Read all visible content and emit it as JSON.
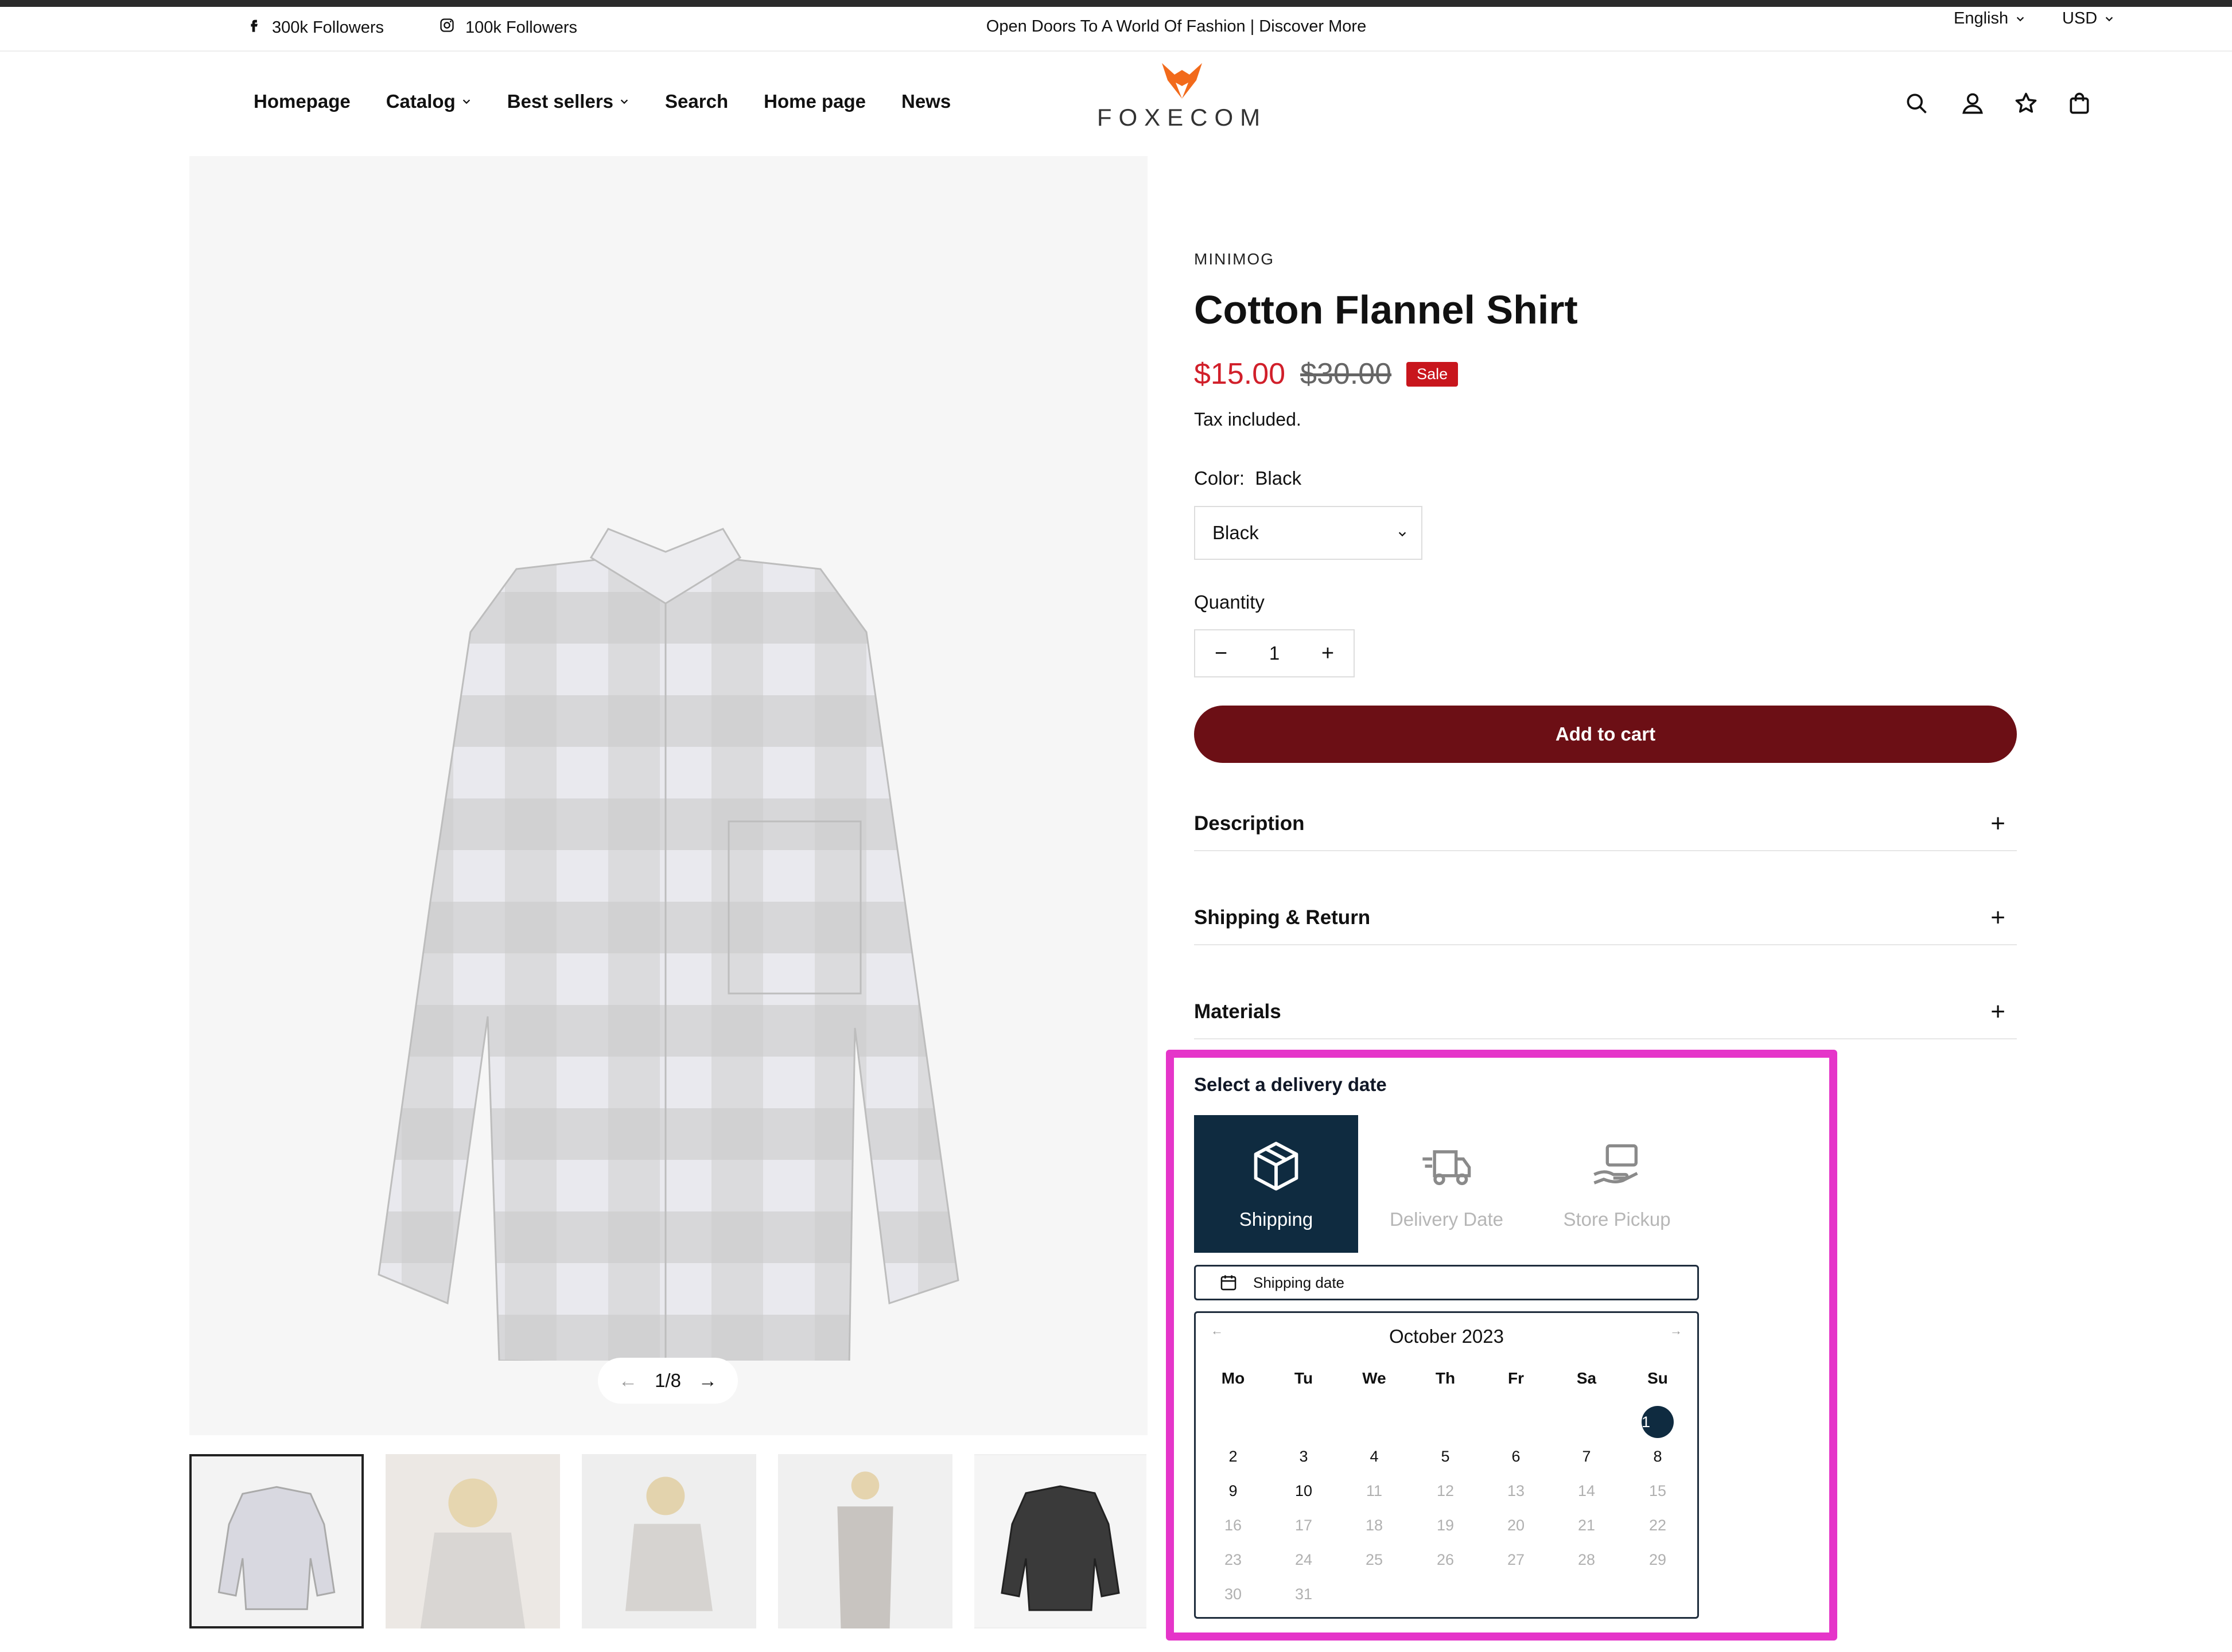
{
  "announcement": {
    "facebook": "300k Followers",
    "instagram": "100k Followers",
    "message": "Open Doors To A World Of Fashion | Discover More",
    "language": "English",
    "currency": "USD"
  },
  "header": {
    "logo_text": "FOXECOM",
    "nav": [
      "Homepage",
      "Catalog",
      "Best sellers",
      "Search",
      "Home page",
      "News"
    ]
  },
  "gallery": {
    "counter": "1/8",
    "thumbnails": [
      "grey plaid shirt",
      "model back view",
      "model seated",
      "model full outfit",
      "black plaid shirt"
    ]
  },
  "product": {
    "vendor": "MINIMOG",
    "title": "Cotton Flannel Shirt",
    "price": "$15.00",
    "compare_price": "$30.00",
    "badge": "Sale",
    "tax_note": "Tax included.",
    "color_label": "Color:",
    "color_value": "Black",
    "color_select": "Black",
    "quantity_label": "Quantity",
    "quantity": "1",
    "add_to_cart": "Add to cart",
    "accordions": [
      "Description",
      "Shipping & Return",
      "Materials"
    ]
  },
  "delivery": {
    "title": "Select a delivery date",
    "options": [
      "Shipping",
      "Delivery Date",
      "Store Pickup"
    ],
    "input_placeholder": "Shipping date",
    "month": "October 2023",
    "weekdays": [
      "Mo",
      "Tu",
      "We",
      "Th",
      "Fr",
      "Sa",
      "Su"
    ],
    "selected_day": 1,
    "available_days": [
      1,
      2,
      3,
      4,
      5,
      6,
      7,
      8,
      9,
      10
    ],
    "disabled_days": [
      11,
      12,
      13,
      14,
      15,
      16,
      17,
      18,
      19,
      20,
      21,
      22,
      23,
      24,
      25,
      26,
      27,
      28,
      29,
      30,
      31
    ]
  },
  "colors": {
    "accent_dark": "#0f2b40",
    "cart_button": "#6c0f15",
    "sale": "#c8161d",
    "highlight": "#e535c9"
  }
}
